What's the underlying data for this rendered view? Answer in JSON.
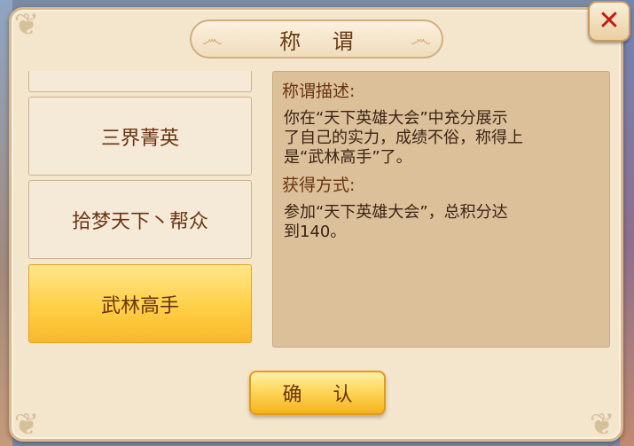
{
  "dialog": {
    "title": "称 谓",
    "close_icon": "close-x-icon"
  },
  "title_list": {
    "items": [
      {
        "label": ""
      },
      {
        "label": "三界菁英"
      },
      {
        "label": "拾梦天下丶帮众"
      },
      {
        "label": "武林高手",
        "selected": true
      }
    ]
  },
  "description": {
    "desc_heading": "称谓描述:",
    "desc_lines": [
      "你在“天下英雄大会”中充分展示",
      "了自己的实力，成绩不俗，称得上",
      "是“武林高手”了。"
    ],
    "obtain_heading": "获得方式:",
    "obtain_lines": [
      "参加“天下英雄大会”，总积分达",
      "到140。"
    ]
  },
  "buttons": {
    "confirm_label": "确 认"
  },
  "colors": {
    "selected_item": "#ffcf46",
    "close_x": "#c31a14",
    "text_brown": "#6b3410"
  }
}
